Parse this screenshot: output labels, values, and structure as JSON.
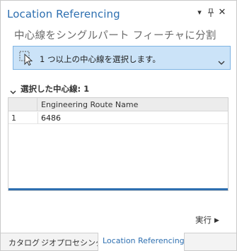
{
  "pane": {
    "title": "Location Referencing",
    "options_icon": "chevron-down-icon",
    "pin_icon": "pin-icon",
    "close_icon": "close-icon"
  },
  "tool": {
    "subtitle": "中心線をシングルパート フィーチャに分割"
  },
  "selector": {
    "icon": "select-features-icon",
    "label": "1 つ以上の中心線を選択します。"
  },
  "selected_section": {
    "label": "選択した中心線: 1"
  },
  "table": {
    "columns": [
      "",
      "Engineering Route Name"
    ],
    "rows": [
      {
        "index": "1",
        "value": "6486"
      }
    ]
  },
  "run_button": {
    "label": "実行",
    "arrow": "▶"
  },
  "tabs": [
    {
      "label": "カタログ"
    },
    {
      "label": "ジオプロセシング"
    },
    {
      "label": "Location Referencing"
    }
  ],
  "colors": {
    "accent": "#2d6fb0",
    "selector_bg": "#cbe3f8",
    "selector_border": "#7fb4e3"
  }
}
